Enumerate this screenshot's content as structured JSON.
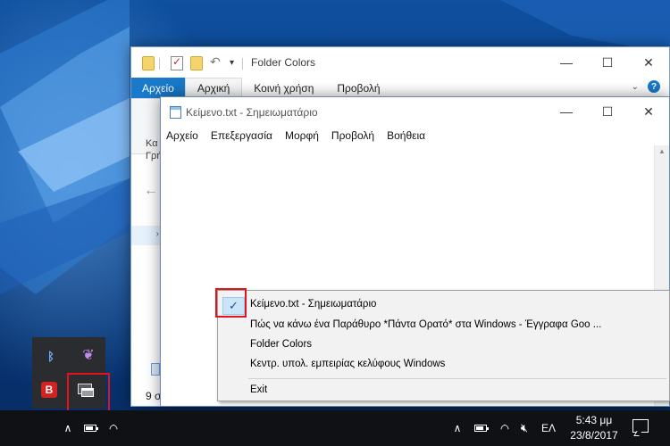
{
  "explorer": {
    "title": "Folder Colors",
    "tabs": [
      {
        "label": "Αρχείο"
      },
      {
        "label": "Αρχική"
      },
      {
        "label": "Κοινή χρήση"
      },
      {
        "label": "Προβολή"
      }
    ],
    "ribbon_cut_label_1": "Κα",
    "ribbon_cut_label_2": "Γρή",
    "status_text": "9 σ",
    "icons": [
      "folder-icon",
      "checkmark-icon",
      "folder-icon",
      "undo-icon",
      "dropdown-icon",
      "back-arrow-icon",
      "expand-icon",
      "help-icon"
    ]
  },
  "notepad": {
    "title": "Κείμενο.txt - Σημειωματάριο",
    "menu": [
      {
        "label": "Αρχείο"
      },
      {
        "label": "Επεξεργασία"
      },
      {
        "label": "Μορφή"
      },
      {
        "label": "Προβολή"
      },
      {
        "label": "Βοήθεια"
      }
    ],
    "content": ""
  },
  "context_menu": {
    "items": [
      {
        "label": "Κείμενο.txt - Σημειωματάριο",
        "checked": true
      },
      {
        "label": "Πώς να κάνω ένα Παράθυρο *Πάντα Ορατό* στα Windows - Έγγραφα Goo ..."
      },
      {
        "label": "Folder Colors"
      },
      {
        "label": "Κεντρ. υπολ. εμπειρίας κελύφους Windows"
      },
      {
        "label": "Exit"
      }
    ]
  },
  "tray_overflow": {
    "icons": [
      "bluetooth-icon",
      "feather-icon",
      "bitdefender-icon",
      "window-on-top-icon"
    ],
    "b_label": "B",
    "highlight_color": "#e2141b"
  },
  "taskbar": {
    "language": "ΕΛ",
    "time": "5:43 μμ",
    "date": "23/8/2017",
    "icons": [
      "chevron-up-icon",
      "battery-icon",
      "wifi-icon",
      "volume-muted-icon",
      "notification-icon"
    ]
  },
  "colors": {
    "accent": "#1979ca",
    "taskbar": "#101114",
    "menu_highlight": "#cce4f7",
    "annotation": "#e2141b"
  }
}
